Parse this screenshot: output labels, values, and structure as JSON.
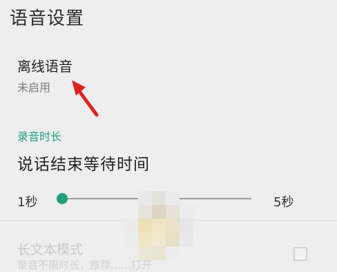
{
  "header": {
    "title": "语音设置"
  },
  "offline_voice": {
    "title": "离线语音",
    "summary": "未启用"
  },
  "recording": {
    "section_title": "录音时长",
    "wait_title": "说话结束等待时间",
    "slider": {
      "min_label": "1秒",
      "max_label": "5秒",
      "level": 0
    }
  },
  "long_text": {
    "title": "长文本模式",
    "summary": "录音不限时长，推荐……打开",
    "checked": false
  },
  "colors": {
    "accent": "#1e9f7f",
    "arrow": "#e02020"
  }
}
